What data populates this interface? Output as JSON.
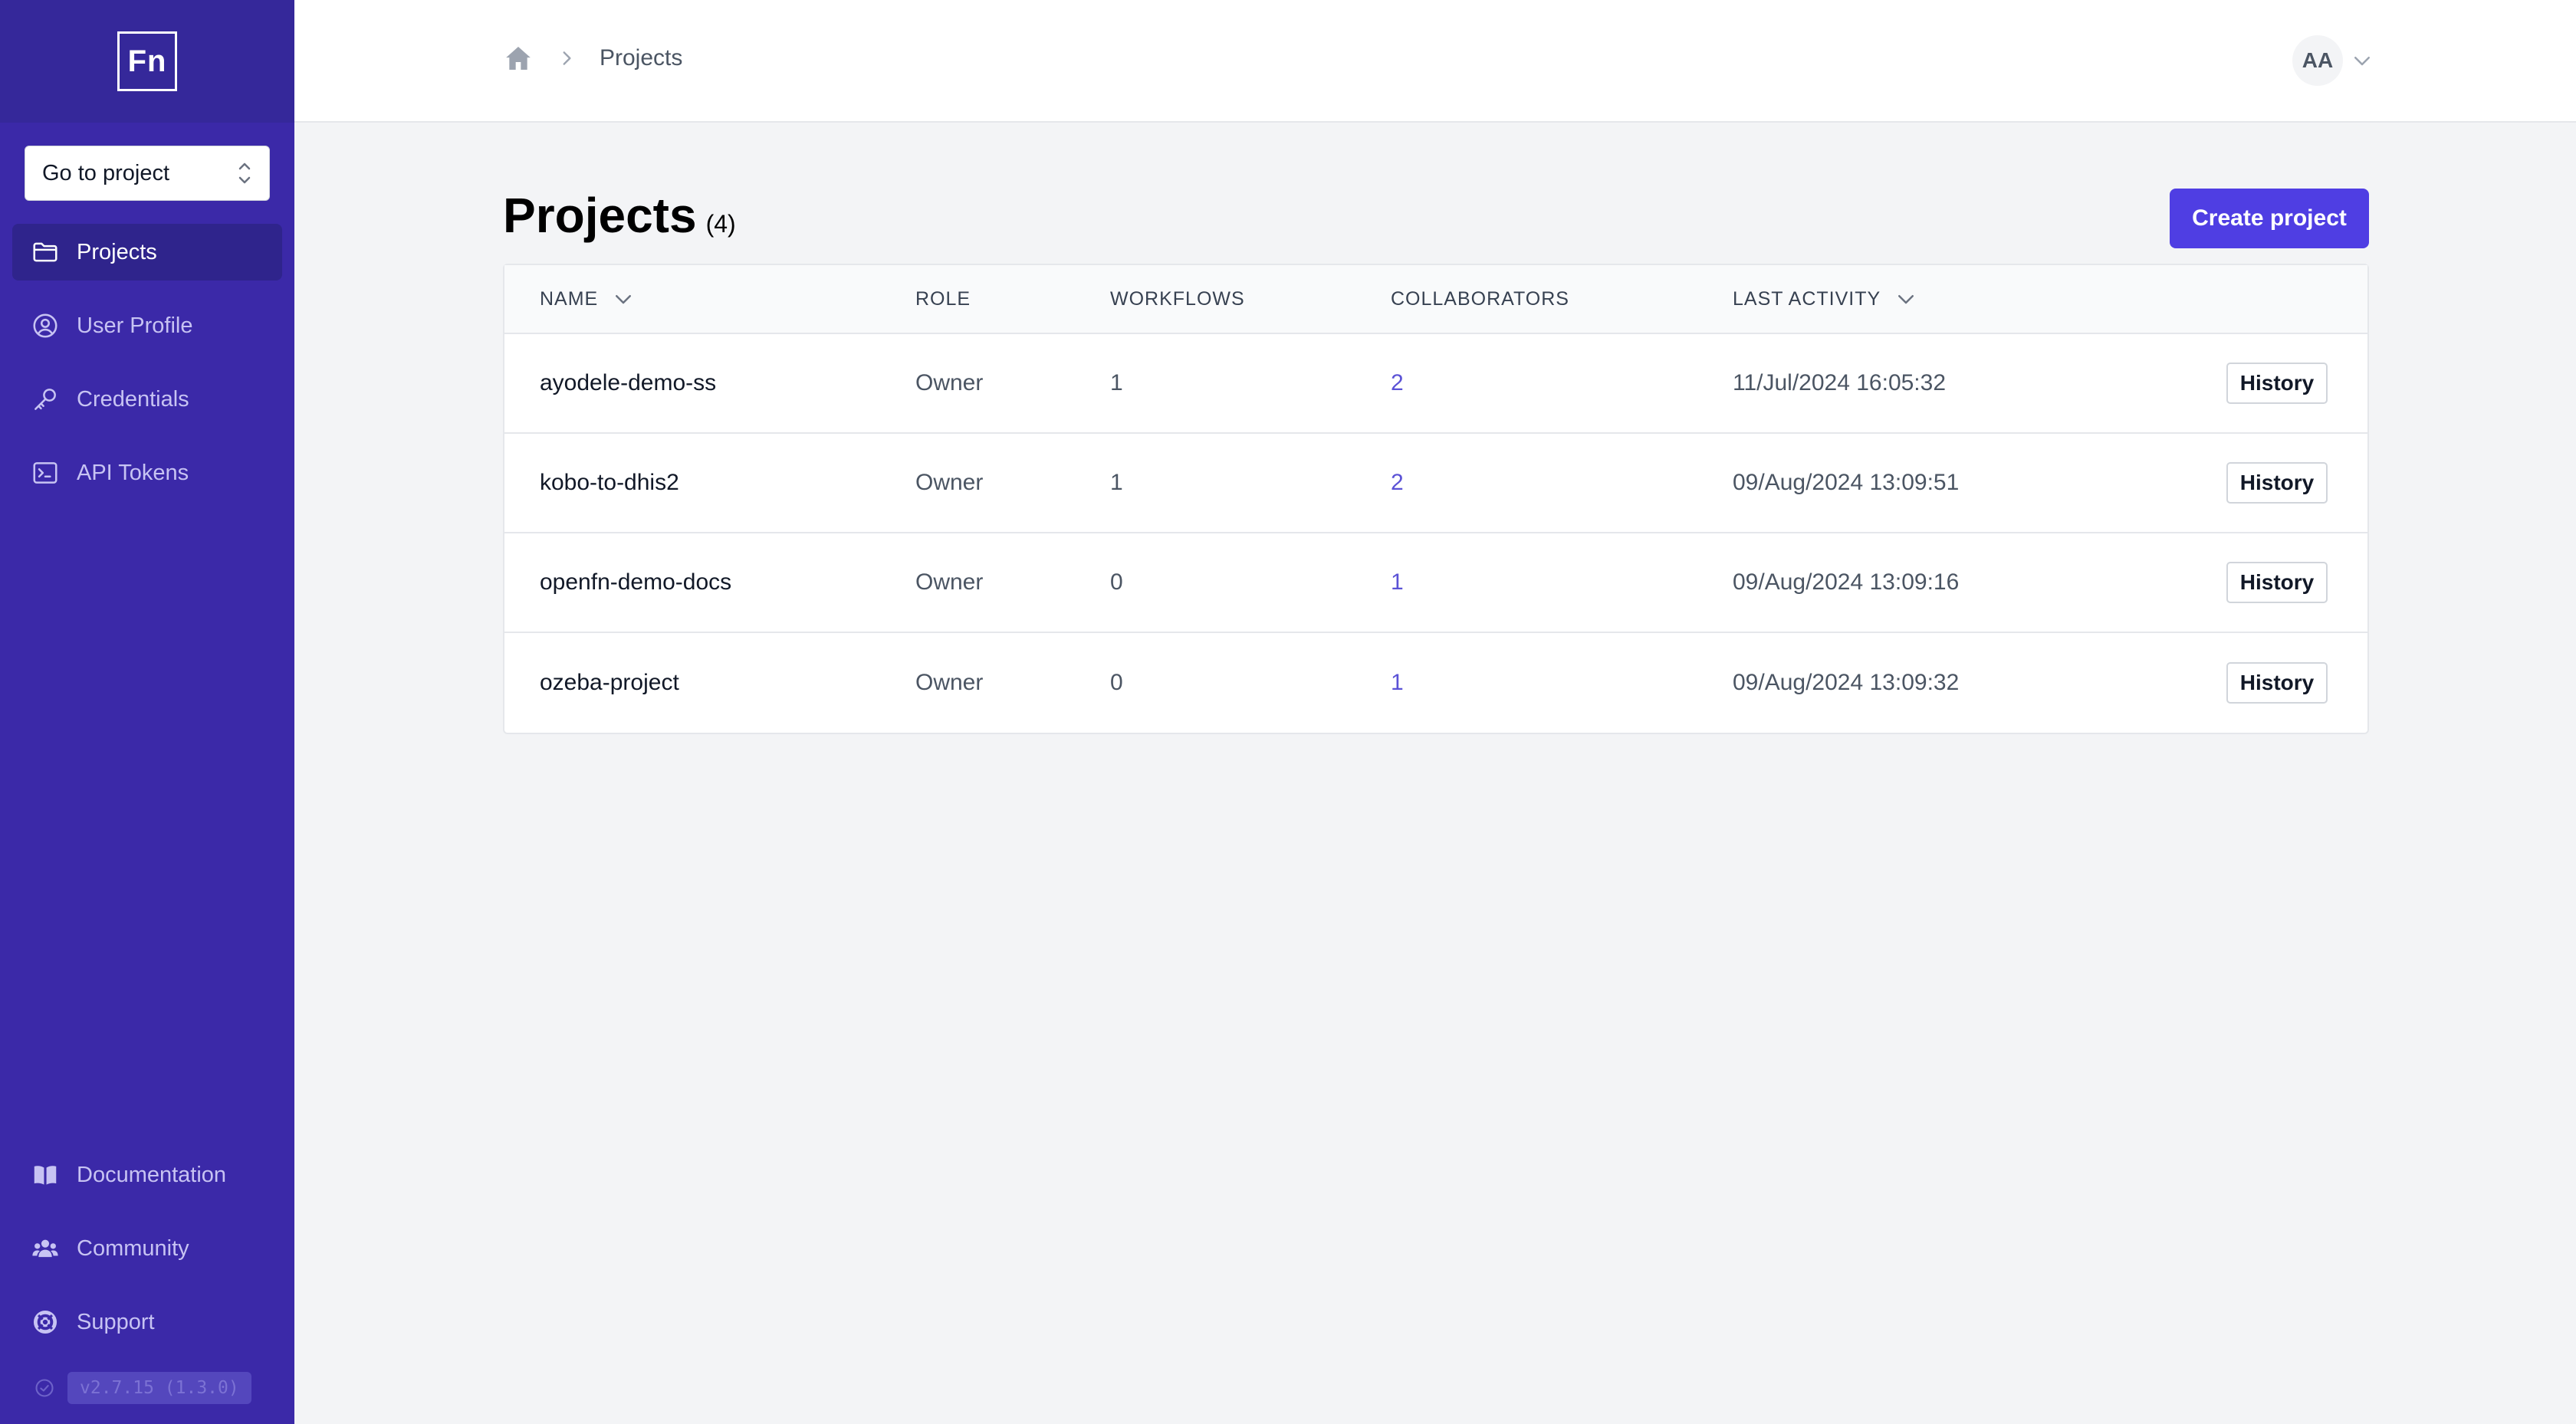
{
  "sidebar": {
    "logo_text": "Fn",
    "project_picker": {
      "label": "Go to project"
    },
    "nav": [
      {
        "label": "Projects",
        "icon": "folder-icon",
        "active": true
      },
      {
        "label": "User Profile",
        "icon": "user-circle-icon"
      },
      {
        "label": "Credentials",
        "icon": "key-icon"
      },
      {
        "label": "API Tokens",
        "icon": "terminal-icon"
      }
    ],
    "bottom_nav": [
      {
        "label": "Documentation",
        "icon": "book-icon"
      },
      {
        "label": "Community",
        "icon": "users-icon"
      },
      {
        "label": "Support",
        "icon": "lifebuoy-icon"
      }
    ],
    "version": "v2.7.15 (1.3.0)"
  },
  "header": {
    "breadcrumb": {
      "current": "Projects"
    },
    "user_initials": "AA"
  },
  "main": {
    "title": "Projects",
    "count": "(4)",
    "create_label": "Create project",
    "table": {
      "columns": {
        "name": "NAME",
        "role": "ROLE",
        "workflows": "WORKFLOWS",
        "collaborators": "COLLABORATORS",
        "last_activity": "LAST ACTIVITY"
      },
      "rows": [
        {
          "name": "ayodele-demo-ss",
          "role": "Owner",
          "workflows": "1",
          "collaborators": "2",
          "last_activity": "11/Jul/2024 16:05:32",
          "action": "History"
        },
        {
          "name": "kobo-to-dhis2",
          "role": "Owner",
          "workflows": "1",
          "collaborators": "2",
          "last_activity": "09/Aug/2024 13:09:51",
          "action": "History"
        },
        {
          "name": "openfn-demo-docs",
          "role": "Owner",
          "workflows": "0",
          "collaborators": "1",
          "last_activity": "09/Aug/2024 13:09:16",
          "action": "History"
        },
        {
          "name": "ozeba-project",
          "role": "Owner",
          "workflows": "0",
          "collaborators": "1",
          "last_activity": "09/Aug/2024 13:09:32",
          "action": "History"
        }
      ]
    }
  },
  "colors": {
    "sidebar_bg": "#3b29a8",
    "primary_button": "#4f3ee3",
    "link": "#5b52d6"
  }
}
